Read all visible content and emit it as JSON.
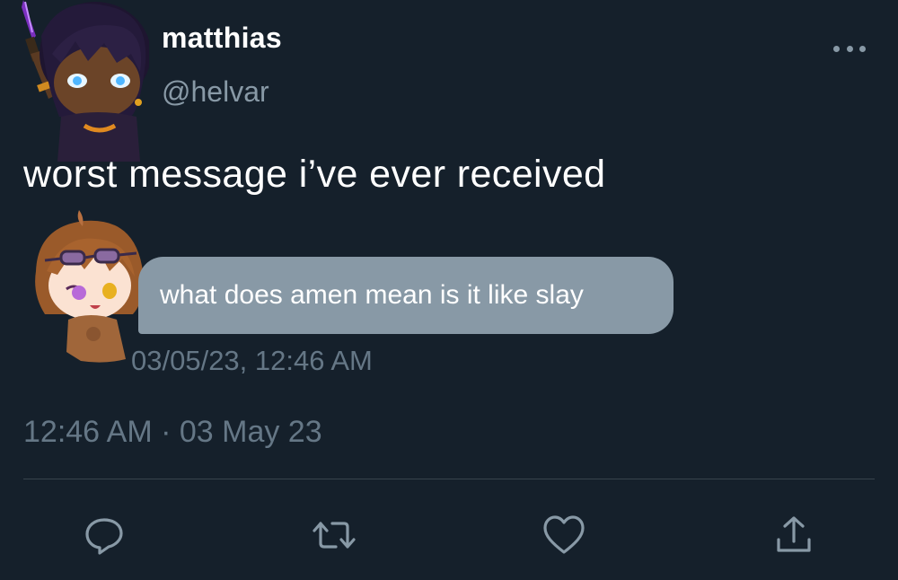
{
  "tweet": {
    "display_name": "matthias",
    "handle": "@helvar",
    "text": "worst message i’ve ever received",
    "timestamp": "12:46 AM · 03 May 23"
  },
  "message": {
    "text": "what does amen mean is it like slay",
    "timestamp": "03/05/23, 12:46 AM",
    "bubble_color": "#8899a6"
  },
  "actions": [
    {
      "icon": "reply-icon"
    },
    {
      "icon": "retweet-icon"
    },
    {
      "icon": "like-icon"
    },
    {
      "icon": "share-icon"
    }
  ],
  "colors": {
    "background": "#15202b",
    "secondary_text": "#8899a6",
    "muted_text": "#657786",
    "divider": "#38444d"
  }
}
